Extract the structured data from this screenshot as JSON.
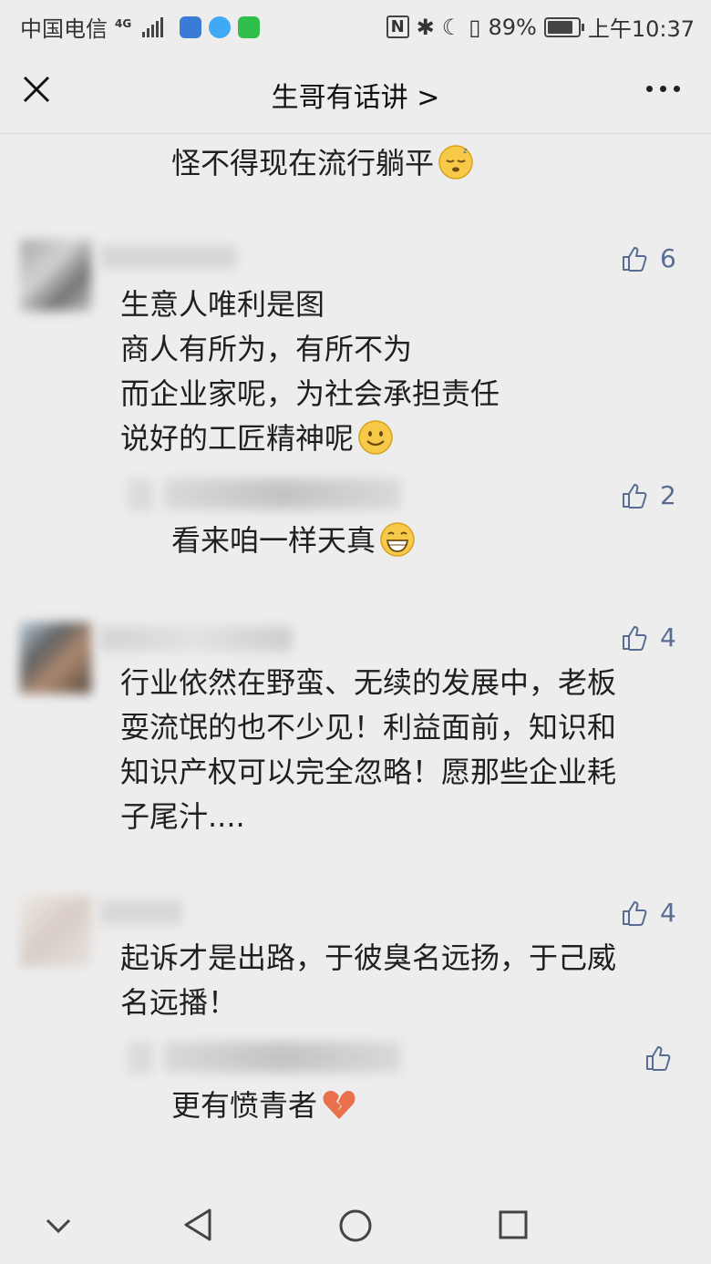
{
  "status_bar": {
    "carrier": "中国电信",
    "network": "4G",
    "battery": "89%",
    "battery_level": 0.89,
    "time": "上午10:37"
  },
  "header": {
    "title": "生哥有话讲 >"
  },
  "comments": [
    {
      "text_lines": [
        "怪不得现在流行躺平"
      ],
      "emoji": "sleeping-face-emoji"
    },
    {
      "likes": "6",
      "text_lines": [
        "生意人唯利是图",
        "商人有所为，有所不为",
        "而企业家呢，为社会承担责任",
        "说好的工匠精神呢"
      ],
      "emoji": "smiling-face-emoji"
    },
    {
      "likes": "2",
      "text_lines": [
        "看来咱一样天真"
      ],
      "emoji": "grinning-face-emoji"
    },
    {
      "likes": "4",
      "text_lines": [
        "行业依然在野蛮、无续的发展中，老板",
        "耍流氓的也不少见！利益面前，知识和",
        "知识产权可以完全忽略！愿那些企业耗",
        "子尾汁...."
      ]
    },
    {
      "likes": "4",
      "text_lines": [
        "起诉才是出路，于彼臭名远扬，于己威",
        "名远播！"
      ]
    },
    {
      "likes": "",
      "text_lines": [
        "更有愤青者"
      ],
      "emoji": "broken-heart-emoji"
    }
  ],
  "colors": {
    "background": "#ededed",
    "like_accent": "#596c94"
  }
}
